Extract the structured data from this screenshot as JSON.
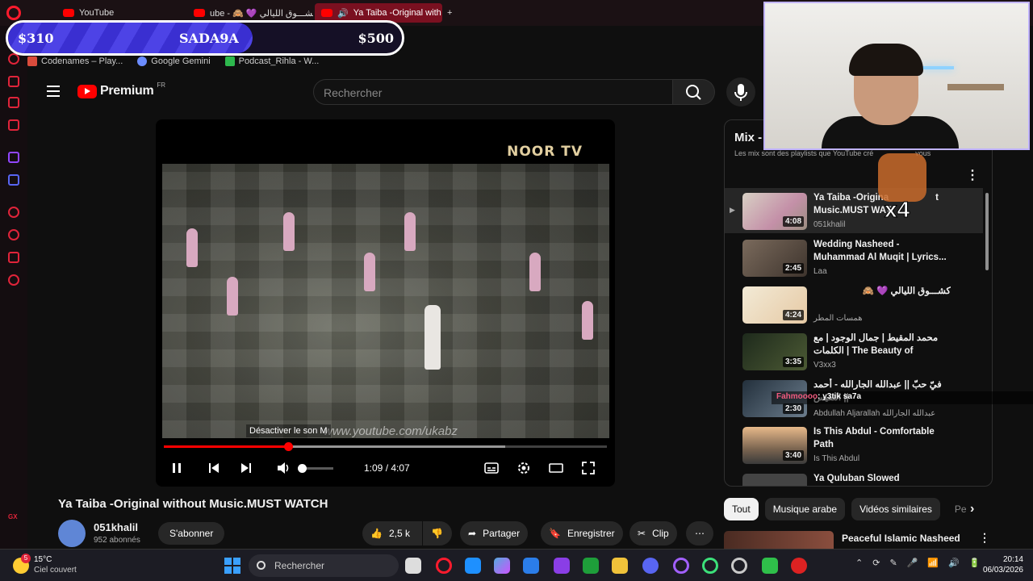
{
  "browser": {
    "tabs": [
      {
        "label": "YouTube"
      },
      {
        "label": "ube - 🙈 💜 كشـــوق الليالي"
      },
      {
        "label": "Ya Taiba -Original with"
      }
    ],
    "new_tab_label": "+",
    "bookmarks": [
      "Codenames – Play...",
      "Google Gemini",
      "Podcast_Rihla - W..."
    ]
  },
  "goal_overlay": {
    "left": "$310",
    "center": "SADA9A",
    "right": "$500",
    "progress_fraction": 0.62
  },
  "header": {
    "logo_text": "Premium",
    "region": "FR",
    "search_placeholder": "Rechercher"
  },
  "player": {
    "channel_watermark": "NOOR TV",
    "url_watermark": "www.youtube.com/ukabz",
    "mute_tooltip": "Désactiver le son  M",
    "time": "1:09 / 4:07",
    "played_fraction": 0.28,
    "buffered_fraction": 0.77,
    "volume_fraction": 0.0
  },
  "video": {
    "title": "Ya Taiba -Original without Music.MUST WATCH",
    "channel": "051khalil",
    "subscribers": "952 abonnés",
    "subscribe_label": "S'abonner",
    "likes": "2,5 k",
    "share_label": "Partager",
    "save_label": "Enregistrer",
    "clip_label": "Clip"
  },
  "mix": {
    "title": "Mix -",
    "subtitle": "Les mix sont des playlists que YouTube cré",
    "subtitle_tail": "vous",
    "items": [
      {
        "title": "Ya Taiba -Origina",
        "title_tail": "t",
        "line2": "Music.MUST WAT",
        "channel": "051khalil",
        "duration": "4:08"
      },
      {
        "title": "Wedding Nasheed - Muhammad Al Muqit | Lyrics...",
        "channel": "Laa",
        "duration": "2:45"
      },
      {
        "title": "كشـــوق الليالي 💜 🙈",
        "channel": "همسات المطر",
        "duration": "4:24"
      },
      {
        "title": "محمد المقيط | جمال الوجود | مع الكلمات | The Beauty of Existence with...",
        "channel": "V3xx3",
        "duration": "3:35"
      },
      {
        "title": "فيّ حبّ || عبدالله الجارالله - أحمد النفيس ||",
        "channel": "Abdullah Aljarallah عبدالله الجارالله",
        "duration": "2:30"
      },
      {
        "title": "Is This Abdul - Comfortable Path",
        "channel": "Is This Abdul",
        "duration": "3:40"
      },
      {
        "title": "Ya Quluban Slowed",
        "channel": "",
        "duration": ""
      }
    ]
  },
  "chips": [
    "Tout",
    "Musique arabe",
    "Vidéos similaires",
    "Pe"
  ],
  "recommendation": {
    "title": "Peaceful Islamic Nasheed"
  },
  "stream_overlay": {
    "chat_user": "Fahmoooo",
    "chat_text": ": y3tik sa7a",
    "multiplier": "x4"
  },
  "taskbar": {
    "weather_temp": "15°C",
    "weather_desc": "Ciel couvert",
    "weather_badge": "5",
    "search_placeholder": "Rechercher",
    "time": "20:14",
    "date": "06/03/2026"
  },
  "sidebar": {
    "gx_label": "GX"
  }
}
